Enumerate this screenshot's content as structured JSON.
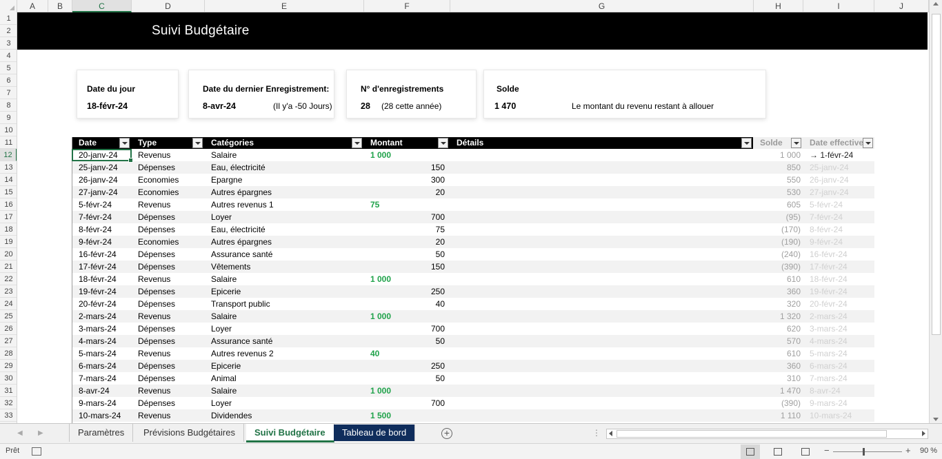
{
  "columns": [
    "A",
    "B",
    "C",
    "D",
    "E",
    "F",
    "G",
    "H",
    "I",
    "J"
  ],
  "selected_column": "C",
  "rows_start": 1,
  "rows_end": 33,
  "selected_row": 12,
  "banner": {
    "title": "Suivi Budgétaire"
  },
  "cards": {
    "today": {
      "label": "Date du jour",
      "value": "18-févr-24"
    },
    "last": {
      "label": "Date du dernier Enregistrement:",
      "value": "8-avr-24",
      "note": "(Il y'a -50 Jours)"
    },
    "count": {
      "label": "N° d'enregistrements",
      "value": "28",
      "note": "(28 cette année)"
    },
    "balance": {
      "label": "Solde",
      "value": "1 470",
      "note": "Le montant du revenu restant à allouer"
    }
  },
  "table": {
    "headers": {
      "date": "Date",
      "type": "Type",
      "cat": "Catégories",
      "amount": "Montant",
      "details": "Détails",
      "solde": "Solde",
      "eff": "Date effective"
    },
    "rows": [
      {
        "date": "20-janv-24",
        "type": "Revenus",
        "cat": "Salaire",
        "inc": "1 000",
        "exp": "",
        "solde": "1 000",
        "eff": "→ 1-févr-24"
      },
      {
        "date": "25-janv-24",
        "type": "Dépenses",
        "cat": "Eau, électricité",
        "inc": "",
        "exp": "150",
        "solde": "850",
        "eff": "25-janv-24"
      },
      {
        "date": "26-janv-24",
        "type": "Economies",
        "cat": "Epargne",
        "inc": "",
        "exp": "300",
        "solde": "550",
        "eff": "26-janv-24"
      },
      {
        "date": "27-janv-24",
        "type": "Economies",
        "cat": "Autres épargnes",
        "inc": "",
        "exp": "20",
        "solde": "530",
        "eff": "27-janv-24"
      },
      {
        "date": "5-févr-24",
        "type": "Revenus",
        "cat": "Autres revenus 1",
        "inc": "75",
        "exp": "",
        "solde": "605",
        "eff": "5-févr-24"
      },
      {
        "date": "7-févr-24",
        "type": "Dépenses",
        "cat": "Loyer",
        "inc": "",
        "exp": "700",
        "solde": "(95)",
        "eff": "7-févr-24"
      },
      {
        "date": "8-févr-24",
        "type": "Dépenses",
        "cat": "Eau, électricité",
        "inc": "",
        "exp": "75",
        "solde": "(170)",
        "eff": "8-févr-24"
      },
      {
        "date": "9-févr-24",
        "type": "Economies",
        "cat": "Autres épargnes",
        "inc": "",
        "exp": "20",
        "solde": "(190)",
        "eff": "9-févr-24"
      },
      {
        "date": "16-févr-24",
        "type": "Dépenses",
        "cat": "Assurance santé",
        "inc": "",
        "exp": "50",
        "solde": "(240)",
        "eff": "16-févr-24"
      },
      {
        "date": "17-févr-24",
        "type": "Dépenses",
        "cat": "Vêtements",
        "inc": "",
        "exp": "150",
        "solde": "(390)",
        "eff": "17-févr-24"
      },
      {
        "date": "18-févr-24",
        "type": "Revenus",
        "cat": "Salaire",
        "inc": "1 000",
        "exp": "",
        "solde": "610",
        "eff": "18-févr-24"
      },
      {
        "date": "19-févr-24",
        "type": "Dépenses",
        "cat": "Epicerie",
        "inc": "",
        "exp": "250",
        "solde": "360",
        "eff": "19-févr-24"
      },
      {
        "date": "20-févr-24",
        "type": "Dépenses",
        "cat": "Transport public",
        "inc": "",
        "exp": "40",
        "solde": "320",
        "eff": "20-févr-24"
      },
      {
        "date": "2-mars-24",
        "type": "Revenus",
        "cat": "Salaire",
        "inc": "1 000",
        "exp": "",
        "solde": "1 320",
        "eff": "2-mars-24"
      },
      {
        "date": "3-mars-24",
        "type": "Dépenses",
        "cat": "Loyer",
        "inc": "",
        "exp": "700",
        "solde": "620",
        "eff": "3-mars-24"
      },
      {
        "date": "4-mars-24",
        "type": "Dépenses",
        "cat": "Assurance santé",
        "inc": "",
        "exp": "50",
        "solde": "570",
        "eff": "4-mars-24"
      },
      {
        "date": "5-mars-24",
        "type": "Revenus",
        "cat": "Autres revenus 2",
        "inc": "40",
        "exp": "",
        "solde": "610",
        "eff": "5-mars-24"
      },
      {
        "date": "6-mars-24",
        "type": "Dépenses",
        "cat": "Epicerie",
        "inc": "",
        "exp": "250",
        "solde": "360",
        "eff": "6-mars-24"
      },
      {
        "date": "7-mars-24",
        "type": "Dépenses",
        "cat": "Animal",
        "inc": "",
        "exp": "50",
        "solde": "310",
        "eff": "7-mars-24"
      },
      {
        "date": "8-avr-24",
        "type": "Revenus",
        "cat": "Salaire",
        "inc": "1 000",
        "exp": "",
        "solde": "1 470",
        "eff": "8-avr-24"
      },
      {
        "date": "9-mars-24",
        "type": "Dépenses",
        "cat": "Loyer",
        "inc": "",
        "exp": "700",
        "solde": "(390)",
        "eff": "9-mars-24"
      },
      {
        "date": "10-mars-24",
        "type": "Revenus",
        "cat": "Dividendes",
        "inc": "1 500",
        "exp": "",
        "solde": "1 110",
        "eff": "10-mars-24"
      }
    ]
  },
  "tabs": [
    {
      "label": "Paramètres",
      "state": "normal"
    },
    {
      "label": "Prévisions Budgétaires",
      "state": "normal"
    },
    {
      "label": "Suivi Budgétaire",
      "state": "active"
    },
    {
      "label": "Tableau de bord",
      "state": "dark"
    }
  ],
  "status": {
    "ready": "Prêt",
    "zoom": "90 %"
  },
  "colors": {
    "accent": "#217346",
    "income": "#1fa24a",
    "dark_tab": "#0f2d5c"
  }
}
